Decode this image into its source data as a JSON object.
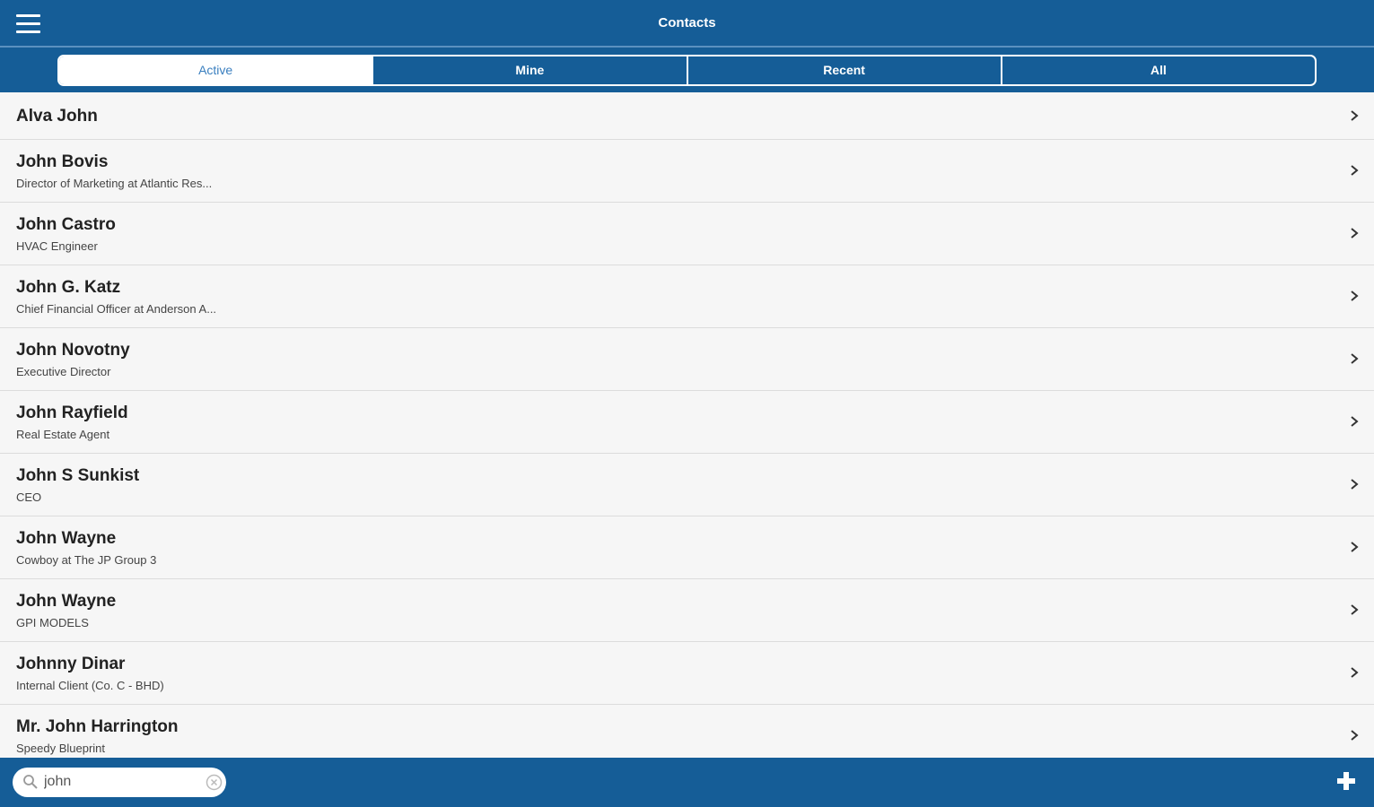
{
  "header": {
    "title": "Contacts",
    "menu_icon": "hamburger-menu-icon"
  },
  "tabs": [
    {
      "label": "Active",
      "selected": true
    },
    {
      "label": "Mine",
      "selected": false
    },
    {
      "label": "Recent",
      "selected": false
    },
    {
      "label": "All",
      "selected": false
    }
  ],
  "contacts": [
    {
      "name": "Alva John",
      "subtitle": ""
    },
    {
      "name": "John Bovis",
      "subtitle": "Director of Marketing at Atlantic Res..."
    },
    {
      "name": "John Castro",
      "subtitle": "HVAC Engineer"
    },
    {
      "name": "John G. Katz",
      "subtitle": "Chief Financial Officer at Anderson A..."
    },
    {
      "name": "John Novotny",
      "subtitle": "Executive Director"
    },
    {
      "name": "John Rayfield",
      "subtitle": "Real Estate Agent"
    },
    {
      "name": "John S Sunkist",
      "subtitle": "CEO"
    },
    {
      "name": "John Wayne",
      "subtitle": "Cowboy at The JP Group 3"
    },
    {
      "name": "John Wayne",
      "subtitle": "GPI MODELS"
    },
    {
      "name": "Johnny Dinar",
      "subtitle": "Internal Client (Co. C - BHD)"
    },
    {
      "name": "Mr. John Harrington",
      "subtitle": "Speedy Blueprint"
    }
  ],
  "search": {
    "value": "john",
    "icon": "search-icon",
    "clear_icon": "clear-icon"
  },
  "actions": {
    "add_icon": "plus-icon"
  },
  "colors": {
    "bar": "#155d97",
    "active_tab_text": "#3a7fbf",
    "row_bg": "#f6f6f6",
    "divider": "#dcdcdc"
  }
}
